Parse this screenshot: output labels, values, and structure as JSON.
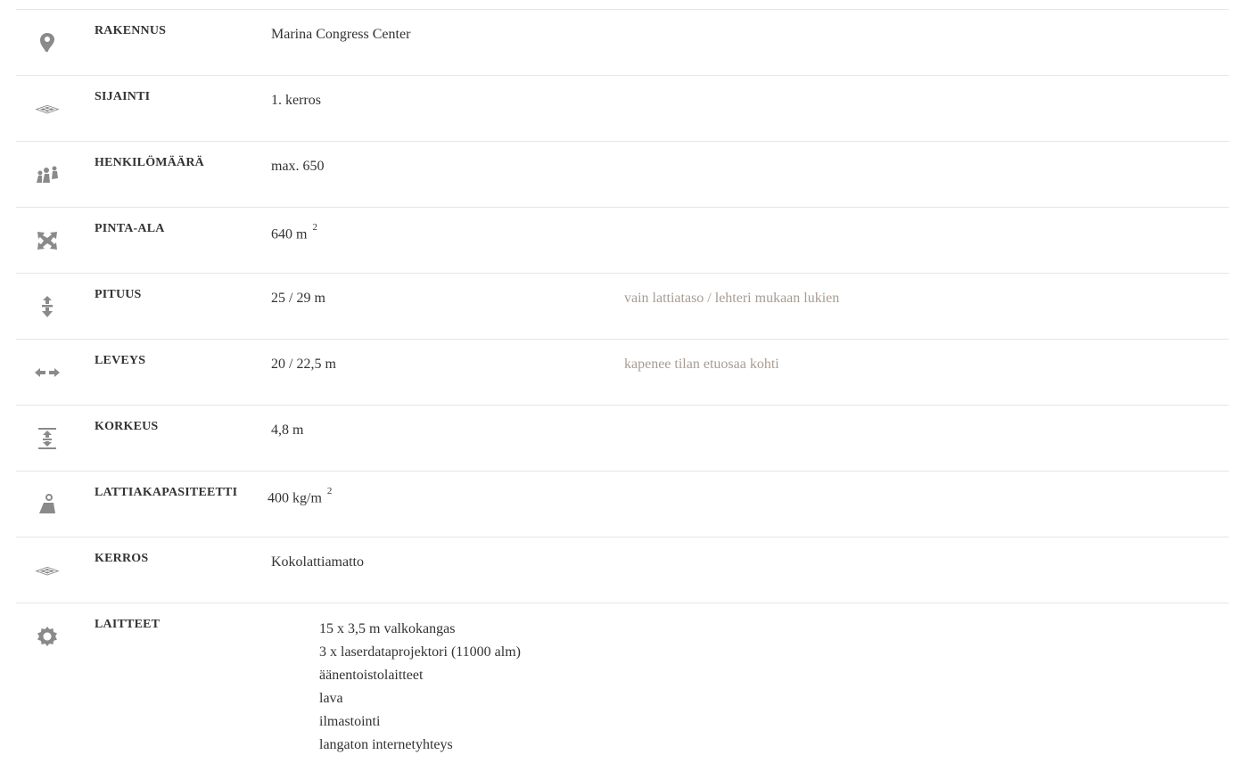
{
  "rows": [
    {
      "label": "RAKENNUS",
      "value": "Marina  Congress   Center",
      "icon": "location-pin-icon"
    },
    {
      "label": "SIJAINTI",
      "value": "1.  kerros",
      "icon": "floor-layers-icon"
    },
    {
      "label": "HENKILÖMÄÄRÄ",
      "value": "max.  650",
      "icon": "people-group-icon"
    },
    {
      "label": "PINTA-ALA",
      "value": "640 m",
      "sup": "2",
      "icon": "area-expand-icon"
    },
    {
      "label": "PITUUS",
      "value": "25  /  29 m",
      "note": "vain  lattiataso   / lehteri  mukaan   lukien",
      "icon": "vertical-arrows-icon"
    },
    {
      "label": "LEVEYS",
      "value": "20  /  22,5 m",
      "note": "kapenee    tilan  etuosaa   kohti",
      "icon": "horizontal-arrows-icon"
    },
    {
      "label": "KORKEUS",
      "value": "4,8 m",
      "icon": "height-icon"
    },
    {
      "label": "LATTIAKAPASITEETTI",
      "value": "400 kg/m",
      "sup": "2",
      "icon": "floor-weight-icon"
    },
    {
      "label": "KERROS",
      "value": "Kokolattiamatto",
      "icon": "floor-layers-icon"
    },
    {
      "label": "LAITTEET",
      "icon": "gear-icon",
      "items": [
        "15  x  3,5  m  valkokangas",
        "3  x  laserdataprojektori    (11000  alm)",
        "äänentoistolaitteet",
        "lava",
        "ilmastointi",
        "langaton   internetyhteys"
      ]
    }
  ],
  "colors": {
    "icon": "#8a8a8a",
    "note": "#a89c92",
    "text": "#333333",
    "divider": "#e6e6e6"
  }
}
